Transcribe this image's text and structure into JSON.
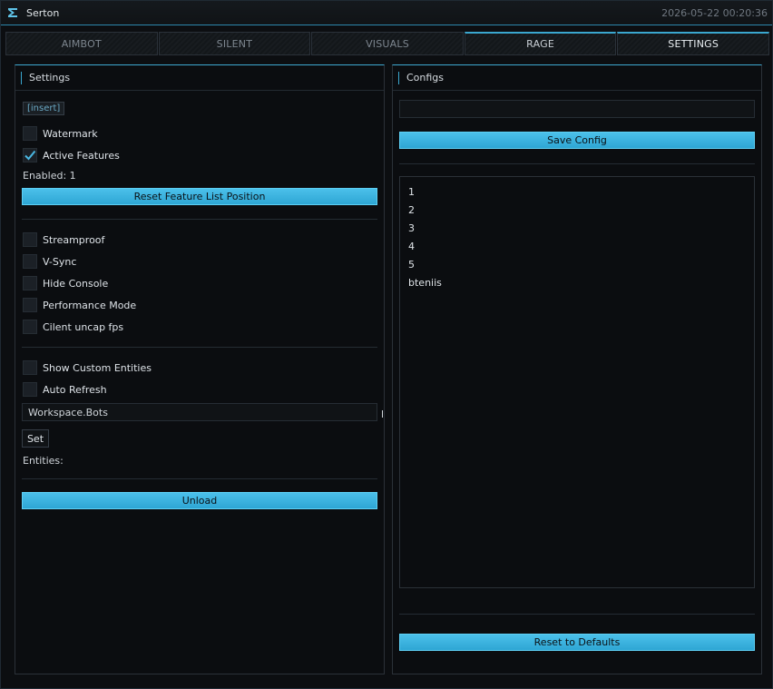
{
  "window": {
    "title": "Serton",
    "timestamp": "2026-05-22 00:20:36",
    "colors": {
      "accent": "#3aa7cf",
      "button": "#3eb5e2",
      "background": "#0c0e11"
    }
  },
  "tabs": [
    {
      "label": "AIMBOT"
    },
    {
      "label": "SILENT"
    },
    {
      "label": "VISUALS"
    },
    {
      "label": "RAGE"
    },
    {
      "label": "SETTINGS"
    }
  ],
  "settings": {
    "header": "Settings",
    "keybind": "[insert]",
    "watermark_label": "Watermark",
    "watermark_checked": false,
    "active_features_label": "Active Features",
    "active_features_checked": true,
    "enabled_text": "Enabled: 1",
    "reset_feature_button": "Reset Feature List Position",
    "streamproof_label": "Streamproof",
    "vsync_label": "V-Sync",
    "hide_console_label": "Hide Console",
    "performance_mode_label": "Performance Mode",
    "client_uncap_label": "Cilent uncap fps",
    "show_custom_entities_label": "Show Custom Entities",
    "auto_refresh_label": "Auto Refresh",
    "entity_path_value": "Workspace.Bots",
    "set_button": "Set",
    "entities_label": "Entities:",
    "unload_button": "Unload"
  },
  "configs": {
    "header": "Configs",
    "name_input_value": "",
    "save_button": "Save Config",
    "list": [
      "1",
      "2",
      "3",
      "4",
      "5",
      "bteniis"
    ],
    "reset_button": "Reset to Defaults"
  }
}
